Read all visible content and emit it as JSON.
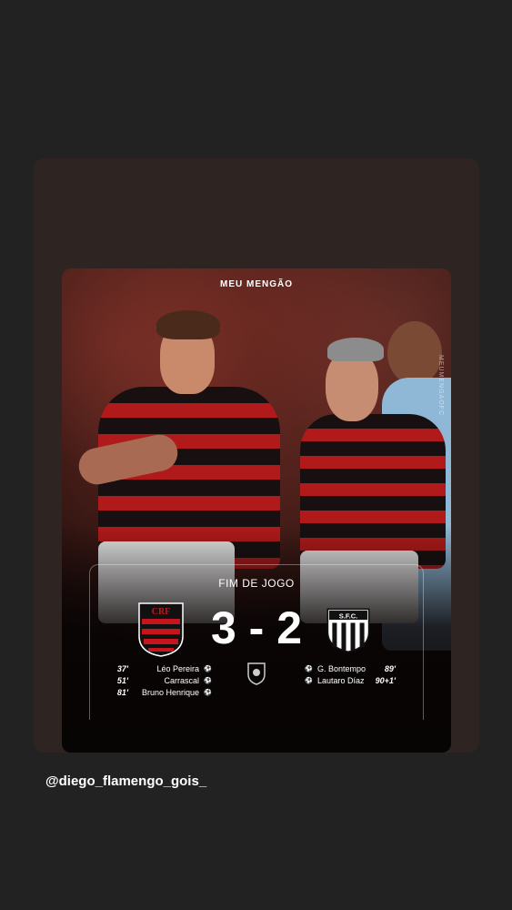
{
  "story": {
    "caption": "@diego_flamengo_gois_"
  },
  "post": {
    "brand": "MEU MENGÃO",
    "side_handle": "MEUMENGAOFC",
    "match": {
      "status": "FIM DE JOGO",
      "home_score": "3",
      "separator": "-",
      "away_score": "2",
      "home_team_crest": "flamengo-crest",
      "away_team_crest": "santos-crest",
      "league_logo": "brasileirao-logo",
      "home_scorers": [
        {
          "minute": "37'",
          "name": "Léo Pereira"
        },
        {
          "minute": "51'",
          "name": "Carrascal"
        },
        {
          "minute": "81'",
          "name": "Bruno Henrique"
        }
      ],
      "away_scorers": [
        {
          "name": "G. Bontempo",
          "minute": "89'"
        },
        {
          "name": "Lautaro Díaz",
          "minute": "90+1'"
        }
      ]
    }
  },
  "colors": {
    "background": "#222222",
    "card": "#2e2522",
    "flamengo_red": "#c4161c",
    "flamengo_black": "#111111"
  }
}
